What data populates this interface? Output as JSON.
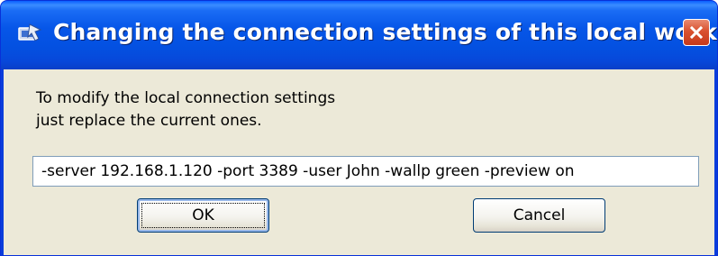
{
  "window": {
    "title": "Changing the connection settings of this local workst..."
  },
  "dialog": {
    "message_line_1": "To modify the local connection settings",
    "message_line_2": "just replace the current ones.",
    "settings_value": "-server 192.168.1.120 -port 3389 -user John -wallp green -preview on",
    "ok_label": "OK",
    "cancel_label": "Cancel"
  },
  "icons": {
    "app": "remote-connection-icon",
    "close": "close-icon"
  },
  "colors": {
    "titlebar_blue": "#0656e8",
    "client_background": "#ece9d8",
    "close_button_red": "#d9512f",
    "input_border": "#7f9db9",
    "button_border": "#003c74"
  }
}
